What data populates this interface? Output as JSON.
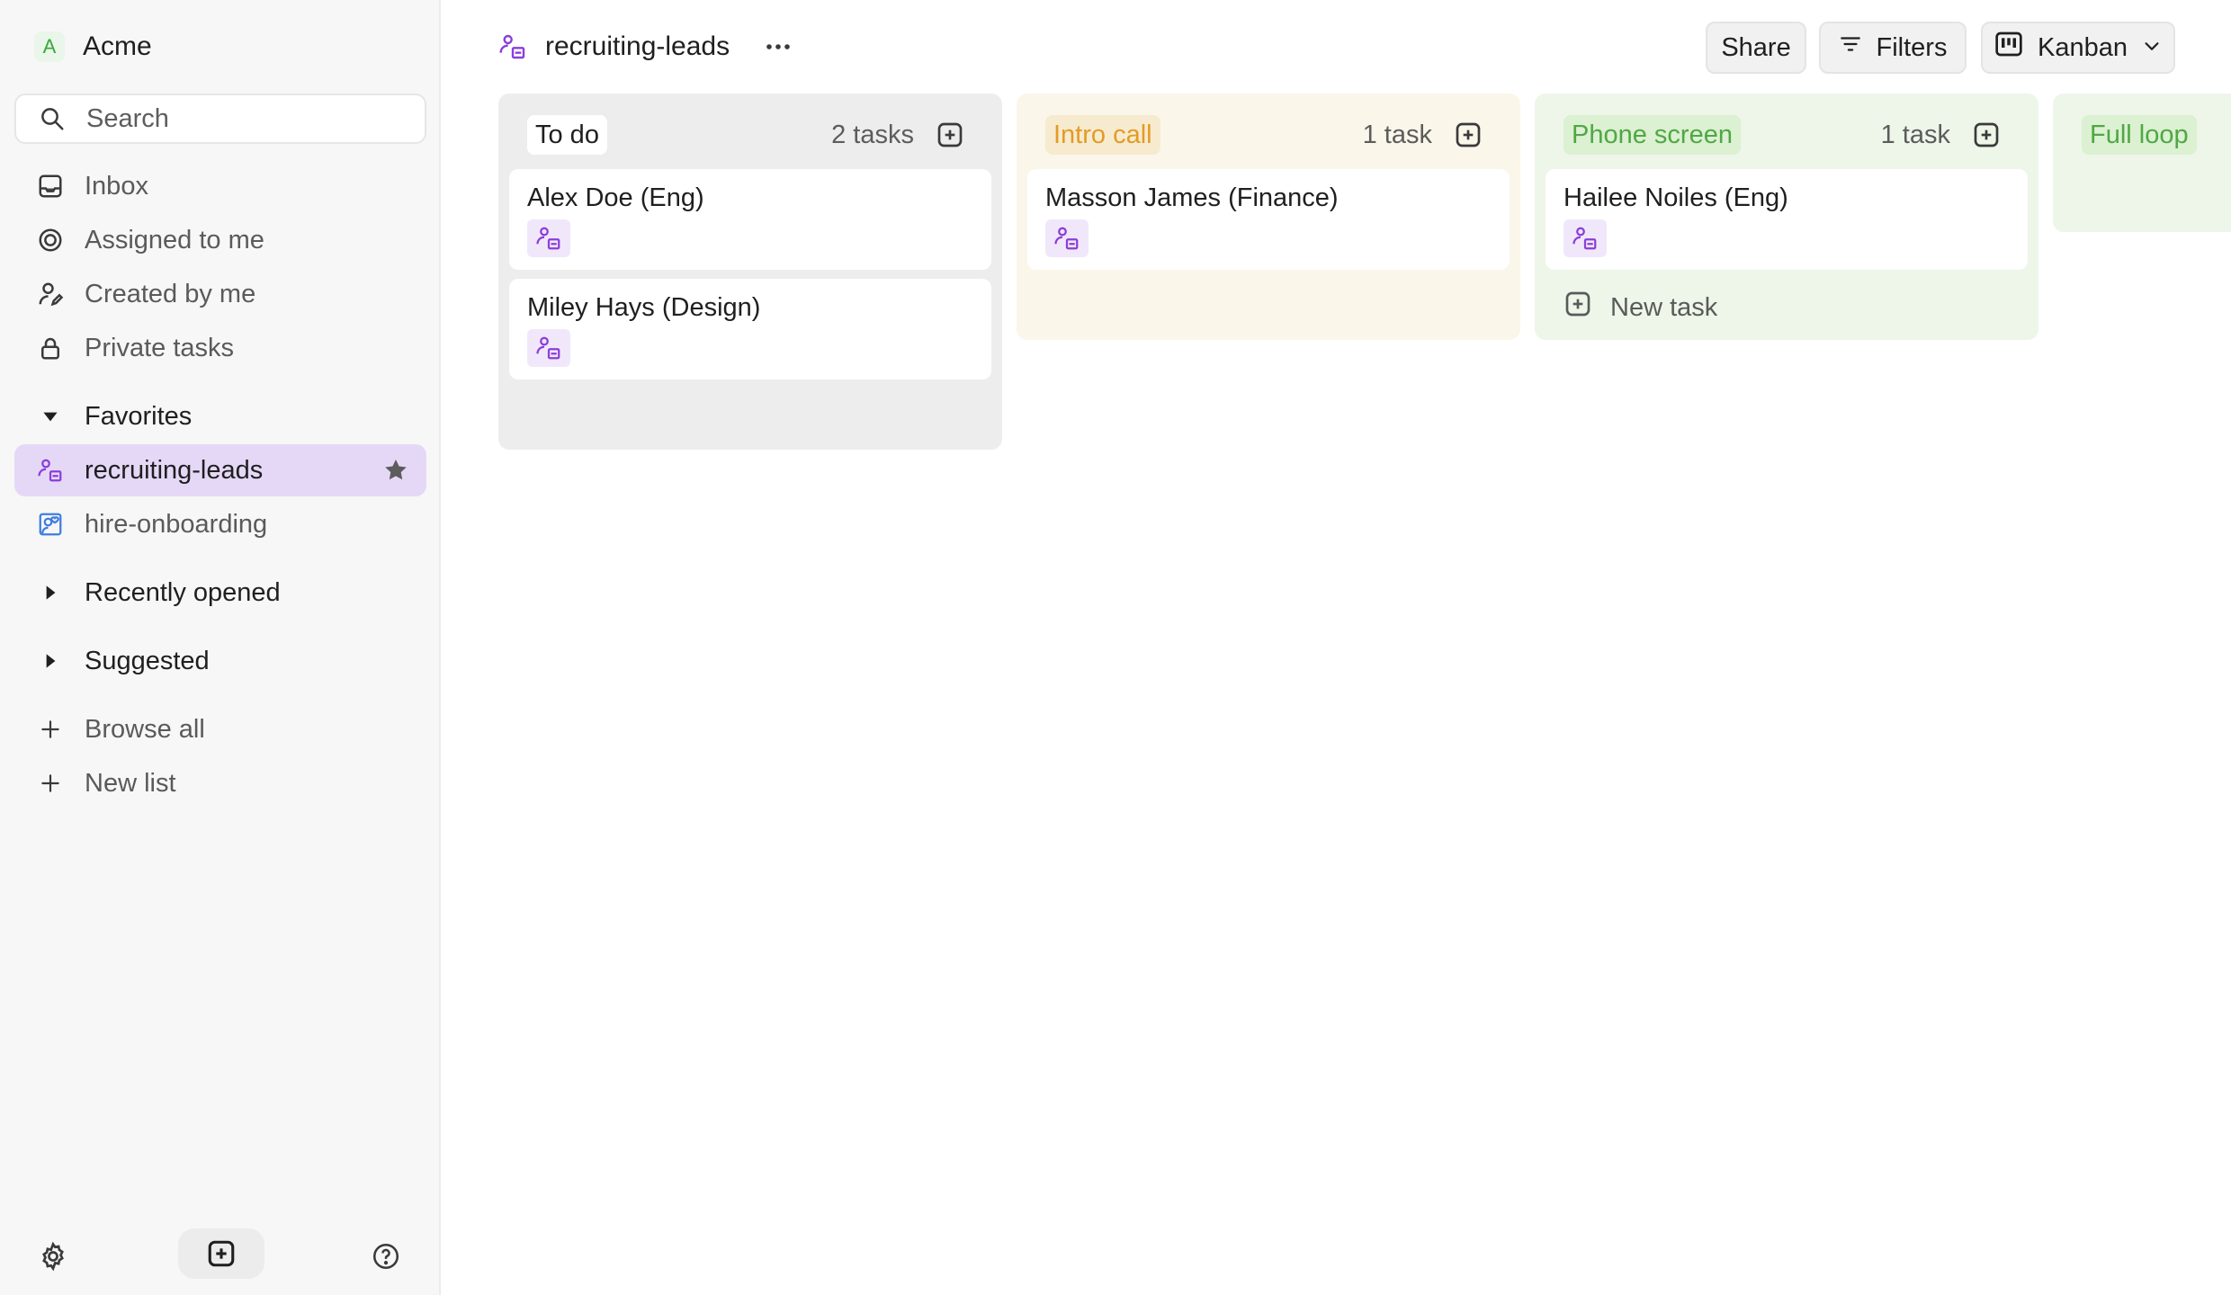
{
  "workspace": {
    "initial": "A",
    "name": "Acme"
  },
  "search": {
    "placeholder": "Search"
  },
  "nav": {
    "inbox": "Inbox",
    "assigned": "Assigned to me",
    "created": "Created by me",
    "private": "Private tasks"
  },
  "favorites": {
    "heading": "Favorites",
    "items": [
      {
        "label": "recruiting-leads",
        "active": true,
        "starred": true
      },
      {
        "label": "hire-onboarding"
      }
    ]
  },
  "sections": {
    "recent": "Recently opened",
    "suggested": "Suggested"
  },
  "actions": {
    "browse_all": "Browse all",
    "new_list": "New list"
  },
  "page": {
    "title": "recruiting-leads"
  },
  "toolbar": {
    "share": "Share",
    "filters": "Filters",
    "view": "Kanban"
  },
  "board": {
    "columns": [
      {
        "label": "To do",
        "count": "2 tasks",
        "label_color": "#1f1f1f",
        "label_bg": "#ffffff",
        "bg": "#ededee",
        "cards": [
          "Alex Doe (Eng)",
          "Miley Hays (Design)"
        ]
      },
      {
        "label": "Intro call",
        "count": "1 task",
        "label_color": "#e39b25",
        "label_bg": "#f7ebcf",
        "bg": "#fbf6ea",
        "cards": [
          "Masson James (Finance)"
        ]
      },
      {
        "label": "Phone screen",
        "count": "1 task",
        "label_color": "#4fa844",
        "label_bg": "#dcf0d2",
        "bg": "#edf6e8",
        "cards": [
          "Hailee Noiles (Eng)"
        ],
        "new_task": "New task"
      },
      {
        "label": "Full loop",
        "label_color": "#4fa844",
        "label_bg": "#dcf0d2",
        "bg": "#edf6e8"
      }
    ]
  },
  "colors": {
    "accent": "#8a3ed8",
    "active_bg": "#e5d8f7",
    "sidebar_bg": "#f7f7f7"
  }
}
